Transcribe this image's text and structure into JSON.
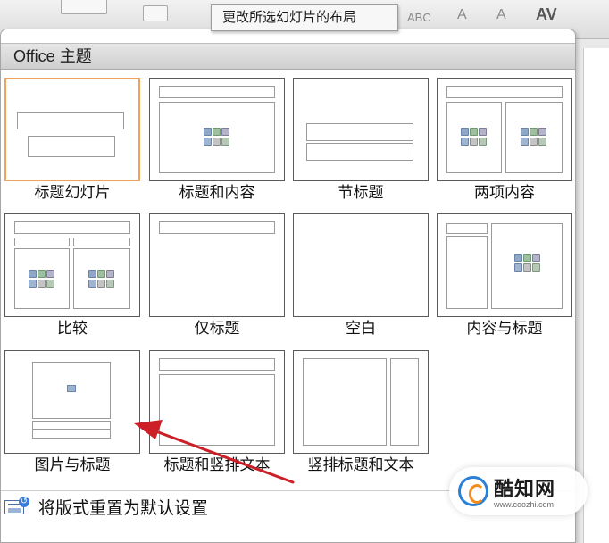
{
  "tooltip": "更改所选幻灯片的布局",
  "ribbon": {
    "glyphs": [
      "ABC",
      "A",
      "A",
      "AV"
    ]
  },
  "gallery": {
    "header": "Office 主题",
    "layouts": [
      {
        "label": "标题幻灯片",
        "kind": "title-slide",
        "selected": true
      },
      {
        "label": "标题和内容",
        "kind": "title-content"
      },
      {
        "label": "节标题",
        "kind": "section-header"
      },
      {
        "label": "两项内容",
        "kind": "two-content"
      },
      {
        "label": "比较",
        "kind": "comparison"
      },
      {
        "label": "仅标题",
        "kind": "title-only"
      },
      {
        "label": "空白",
        "kind": "blank"
      },
      {
        "label": "内容与标题",
        "kind": "content-with-caption"
      },
      {
        "label": "图片与标题",
        "kind": "picture-with-caption"
      },
      {
        "label": "标题和竖排文本",
        "kind": "title-vertical-text"
      },
      {
        "label": "竖排标题和文本",
        "kind": "vertical-title-text"
      }
    ],
    "reset_label": "将版式重置为默认设置"
  },
  "watermark": {
    "title": "酷知网",
    "url": "www.coozhi.com"
  },
  "colors": {
    "selected_border": "#f0a15c",
    "annotation_arrow": "#cc1f28",
    "header_bg": "#d9d9d9"
  }
}
